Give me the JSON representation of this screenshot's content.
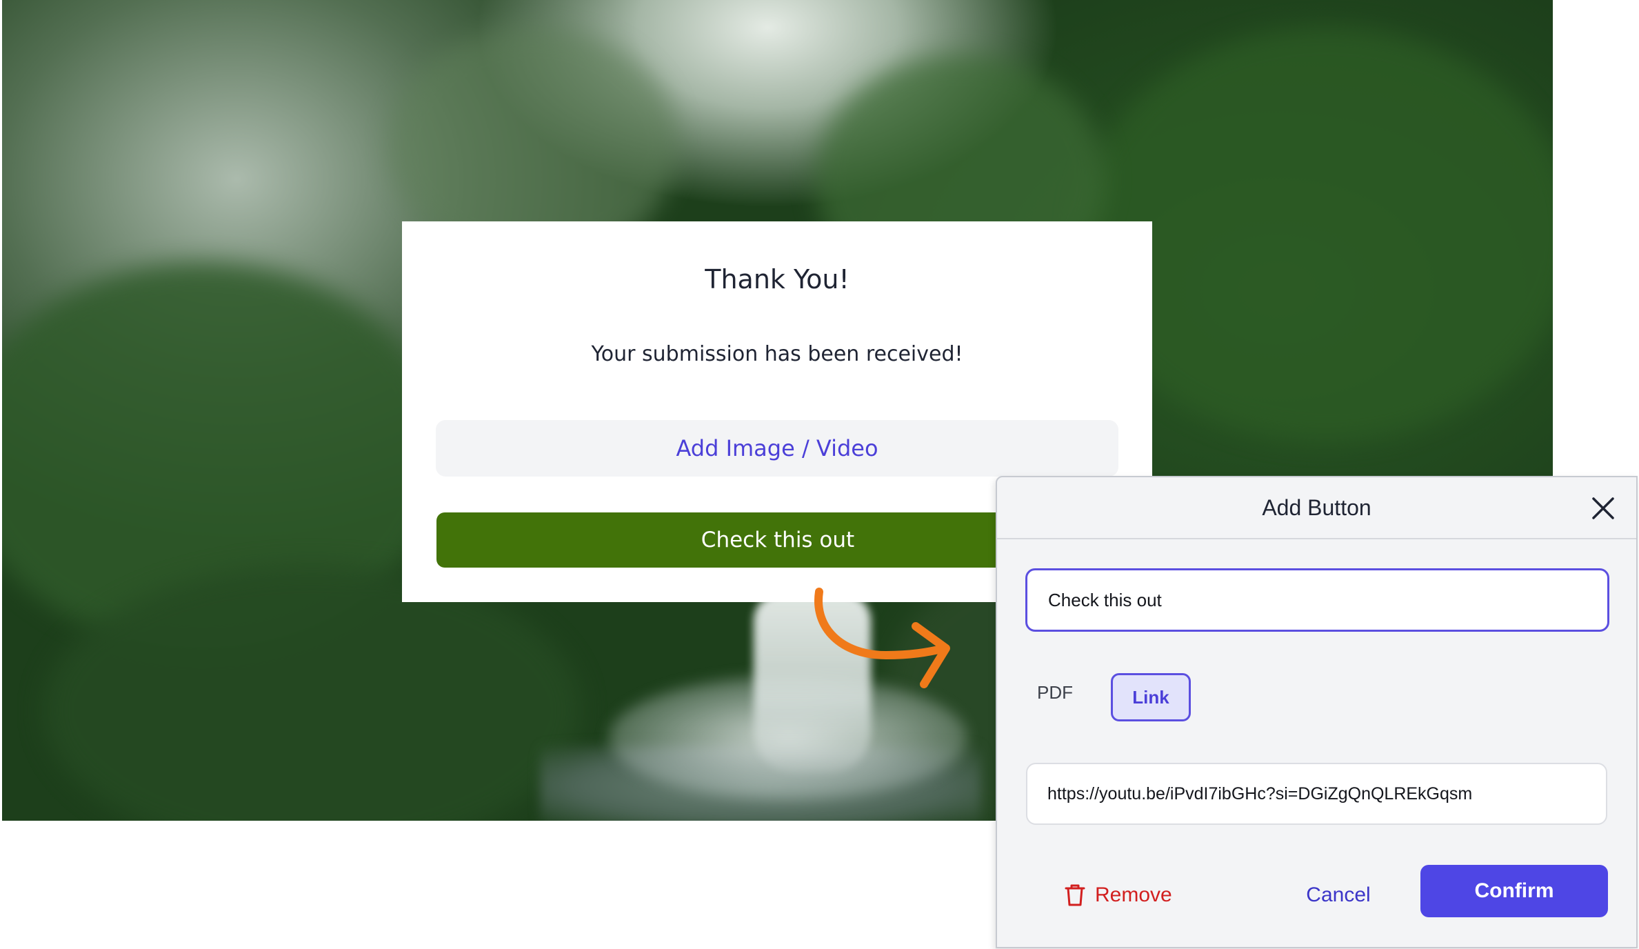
{
  "card": {
    "title": "Thank You!",
    "subtitle": "Your submission has been received!",
    "add_media_label": "Add Image / Video",
    "cta_label": "Check this out"
  },
  "dialog": {
    "title": "Add Button",
    "label_value": "Check this out",
    "types": {
      "pdf": "PDF",
      "link": "Link",
      "selected": "Link"
    },
    "url_value": "https://youtu.be/iPvdI7ibGHc?si=DGiZgQnQLREkGqsm",
    "remove_label": "Remove",
    "cancel_label": "Cancel",
    "confirm_label": "Confirm"
  },
  "colors": {
    "accent": "#4e46e5",
    "cta_green": "#427309",
    "danger": "#d21f1f",
    "arrow": "#f07a1a"
  },
  "icons": {
    "close": "close-icon",
    "trash": "trash-icon",
    "arrow": "curved-arrow-icon"
  }
}
